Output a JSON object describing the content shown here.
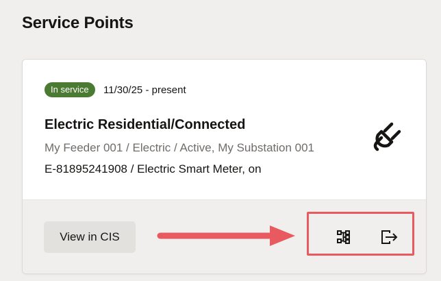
{
  "section": {
    "title": "Service Points"
  },
  "service_point": {
    "status": "In service",
    "date_range": "11/30/25 - present",
    "title": "Electric Residential/Connected",
    "subtitle": "My Feeder 001 / Electric / Active, My Substation 001",
    "meter": "E-81895241908 / Electric Smart Meter, on",
    "status_color": "#4b7a32"
  },
  "actions": {
    "view_label": "View in CIS",
    "hierarchy_icon": "hierarchy-icon",
    "export_icon": "export-arrow-icon"
  },
  "annotation": {
    "highlight_color": "#e85a5f"
  }
}
